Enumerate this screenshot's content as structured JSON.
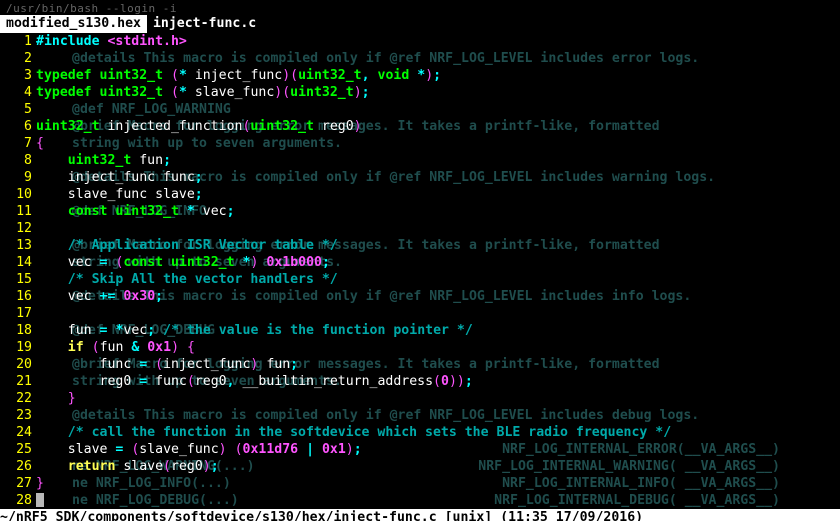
{
  "shell_title": "/usr/bin/bash --login -i",
  "tabs": [
    {
      "label": "modified_s130.hex",
      "active": false
    },
    {
      "label": "inject-func.c",
      "active": true
    }
  ],
  "code": {
    "lines": [
      {
        "n": 1,
        "g": "",
        "tokens": [
          [
            "pp",
            "#include "
          ],
          [
            "str",
            "<stdint.h>"
          ]
        ]
      },
      {
        "n": 2,
        "g": "@details This macro is compiled only if @ref NRF_LOG_LEVEL includes error logs.",
        "tokens": []
      },
      {
        "n": 3,
        "g": "",
        "tokens": [
          [
            "type",
            "typedef"
          ],
          [
            "ident",
            " "
          ],
          [
            "type",
            "uint32_t"
          ],
          [
            "ident",
            " "
          ],
          [
            "paren",
            "("
          ],
          [
            "punc",
            "*"
          ],
          [
            "ident",
            " inject_func"
          ],
          [
            "paren",
            ")("
          ],
          [
            "type",
            "uint32_t"
          ],
          [
            "punc",
            ","
          ],
          [
            "ident",
            " "
          ],
          [
            "type",
            "void"
          ],
          [
            "ident",
            " "
          ],
          [
            "punc",
            "*"
          ],
          [
            "paren",
            ")"
          ],
          [
            "punc",
            ";"
          ]
        ]
      },
      {
        "n": 4,
        "g": "",
        "tokens": [
          [
            "type",
            "typedef"
          ],
          [
            "ident",
            " "
          ],
          [
            "type",
            "uint32_t"
          ],
          [
            "ident",
            " "
          ],
          [
            "paren",
            "("
          ],
          [
            "punc",
            "*"
          ],
          [
            "ident",
            " slave_func"
          ],
          [
            "paren",
            ")("
          ],
          [
            "type",
            "uint32_t"
          ],
          [
            "paren",
            ")"
          ],
          [
            "punc",
            ";"
          ]
        ]
      },
      {
        "n": 5,
        "g": "@def NRF_LOG_WARNING",
        "tokens": []
      },
      {
        "n": 6,
        "g": "@brief Macro for logging error messages. It takes a printf-like, formatted",
        "tokens": [
          [
            "type",
            "uint32_t"
          ],
          [
            "ident",
            " injected_function"
          ],
          [
            "paren",
            "("
          ],
          [
            "type",
            "uint32_t"
          ],
          [
            "ident",
            " reg0"
          ],
          [
            "paren",
            ")"
          ]
        ]
      },
      {
        "n": 7,
        "g": "string with up to seven arguments.",
        "tokens": [
          [
            "paren",
            "{"
          ]
        ]
      },
      {
        "n": 8,
        "g": "",
        "tokens": [
          [
            "ident",
            "    "
          ],
          [
            "type",
            "uint32_t"
          ],
          [
            "ident",
            " fun"
          ],
          [
            "punc",
            ";"
          ]
        ]
      },
      {
        "n": 9,
        "g": "@details This macro is compiled only if @ref NRF_LOG_LEVEL includes warning logs.",
        "tokens": [
          [
            "ident",
            "    inject_func func"
          ],
          [
            "punc",
            ";"
          ]
        ]
      },
      {
        "n": 10,
        "g": "",
        "tokens": [
          [
            "ident",
            "    slave_func slave"
          ],
          [
            "punc",
            ";"
          ]
        ]
      },
      {
        "n": 11,
        "g": "@def NRF_LOG_INFO",
        "tokens": [
          [
            "ident",
            "    "
          ],
          [
            "type",
            "const"
          ],
          [
            "ident",
            " "
          ],
          [
            "type",
            "uint32_t"
          ],
          [
            "ident",
            " "
          ],
          [
            "punc",
            "*"
          ],
          [
            "ident",
            " vec"
          ],
          [
            "punc",
            ";"
          ]
        ]
      },
      {
        "n": 12,
        "g": "",
        "tokens": []
      },
      {
        "n": 13,
        "g": "@brief Macro for logging error messages. It takes a printf-like, formatted",
        "tokens": [
          [
            "ident",
            "    "
          ],
          [
            "comment",
            "/* Application ISR Vector table */"
          ]
        ]
      },
      {
        "n": 14,
        "g": "string with up to seven arguments.",
        "tokens": [
          [
            "ident",
            "    vec "
          ],
          [
            "punc",
            "="
          ],
          [
            "ident",
            " "
          ],
          [
            "paren",
            "("
          ],
          [
            "type",
            "const"
          ],
          [
            "ident",
            " "
          ],
          [
            "type",
            "uint32_t"
          ],
          [
            "ident",
            " "
          ],
          [
            "punc",
            "*"
          ],
          [
            "paren",
            ")"
          ],
          [
            "ident",
            " "
          ],
          [
            "num",
            "0x1b000"
          ],
          [
            "punc",
            ";"
          ]
        ]
      },
      {
        "n": 15,
        "g": "",
        "tokens": [
          [
            "ident",
            "    "
          ],
          [
            "comment",
            "/* Skip All the vector handlers */"
          ]
        ]
      },
      {
        "n": 16,
        "g": "@details This macro is compiled only if @ref NRF_LOG_LEVEL includes info logs.",
        "tokens": [
          [
            "ident",
            "    vec "
          ],
          [
            "punc",
            "+="
          ],
          [
            "ident",
            " "
          ],
          [
            "num",
            "0x30"
          ],
          [
            "punc",
            ";"
          ]
        ]
      },
      {
        "n": 17,
        "g": "",
        "tokens": []
      },
      {
        "n": 18,
        "g": "@def NRF_LOG_DEBUG",
        "tokens": [
          [
            "ident",
            "    fun "
          ],
          [
            "punc",
            "="
          ],
          [
            "ident",
            " "
          ],
          [
            "punc",
            "*"
          ],
          [
            "ident",
            "vec"
          ],
          [
            "punc",
            ";"
          ],
          [
            "ident",
            " "
          ],
          [
            "comment",
            "/* the value is the function pointer */"
          ]
        ]
      },
      {
        "n": 19,
        "g": "",
        "tokens": [
          [
            "ident",
            "    "
          ],
          [
            "keyword",
            "if"
          ],
          [
            "ident",
            " "
          ],
          [
            "paren",
            "("
          ],
          [
            "ident",
            "fun "
          ],
          [
            "punc",
            "&"
          ],
          [
            "ident",
            " "
          ],
          [
            "num",
            "0x1"
          ],
          [
            "paren",
            ")"
          ],
          [
            "ident",
            " "
          ],
          [
            "paren",
            "{"
          ]
        ]
      },
      {
        "n": 20,
        "g": "@brief Macro for logging error messages. It takes a printf-like, formatted",
        "tokens": [
          [
            "ident",
            "        func "
          ],
          [
            "punc",
            "="
          ],
          [
            "ident",
            " "
          ],
          [
            "paren",
            "("
          ],
          [
            "ident",
            "inject_func"
          ],
          [
            "paren",
            ")"
          ],
          [
            "ident",
            " fun"
          ],
          [
            "punc",
            ";"
          ]
        ]
      },
      {
        "n": 21,
        "g": "string with up to seven arguments.",
        "tokens": [
          [
            "ident",
            "        reg0 "
          ],
          [
            "punc",
            "="
          ],
          [
            "ident",
            " func"
          ],
          [
            "paren",
            "("
          ],
          [
            "ident",
            "reg0"
          ],
          [
            "punc",
            ","
          ],
          [
            "ident",
            " __builtin_return_address"
          ],
          [
            "paren",
            "("
          ],
          [
            "num",
            "0"
          ],
          [
            "paren",
            "))"
          ],
          [
            "punc",
            ";"
          ]
        ]
      },
      {
        "n": 22,
        "g": "",
        "tokens": [
          [
            "ident",
            "    "
          ],
          [
            "paren",
            "}"
          ]
        ]
      },
      {
        "n": 23,
        "g": "@details This macro is compiled only if @ref NRF_LOG_LEVEL includes debug logs.",
        "tokens": []
      },
      {
        "n": 24,
        "g": "",
        "tokens": [
          [
            "ident",
            "    "
          ],
          [
            "comment",
            "/* call the function in the softdevice which sets the BLE radio frequency */"
          ]
        ]
      },
      {
        "n": 25,
        "g": "",
        "g2": "NRF_LOG_INTERNAL_ERROR(__VA_ARGS__)",
        "tokens": [
          [
            "ident",
            "    slave "
          ],
          [
            "punc",
            "="
          ],
          [
            "ident",
            " "
          ],
          [
            "paren",
            "("
          ],
          [
            "ident",
            "slave_func"
          ],
          [
            "paren",
            ")"
          ],
          [
            "ident",
            " "
          ],
          [
            "paren",
            "("
          ],
          [
            "num",
            "0x11d76"
          ],
          [
            "ident",
            " "
          ],
          [
            "punc",
            "|"
          ],
          [
            "ident",
            " "
          ],
          [
            "num",
            "0x1"
          ],
          [
            "paren",
            ")"
          ],
          [
            "punc",
            ";"
          ]
        ]
      },
      {
        "n": 26,
        "g": "ne NRF_LOG_WARNING(...)",
        "g2": "NRF_LOG_INTERNAL_WARNING( __VA_ARGS__)",
        "tokens": [
          [
            "ident",
            "    "
          ],
          [
            "keyword",
            "return"
          ],
          [
            "ident",
            " slave"
          ],
          [
            "paren",
            "("
          ],
          [
            "ident",
            "reg0"
          ],
          [
            "paren",
            ")"
          ],
          [
            "punc",
            ";"
          ]
        ]
      },
      {
        "n": 27,
        "g": "ne NRF_LOG_INFO(...)",
        "g2": "NRF_LOG_INTERNAL_INFO( __VA_ARGS__)",
        "tokens": [
          [
            "paren",
            "}"
          ]
        ]
      },
      {
        "n": 28,
        "g": "ne NRF_LOG_DEBUG(...)",
        "g2": "NRF_LOG_INTERNAL_DEBUG( __VA_ARGS__)",
        "tokens": [
          [
            "cursor",
            ""
          ]
        ]
      }
    ]
  },
  "status": "~/nRF5_SDK/components/softdevice/s130/hex/inject-func.c [unix] (11:35 17/09/2016)"
}
